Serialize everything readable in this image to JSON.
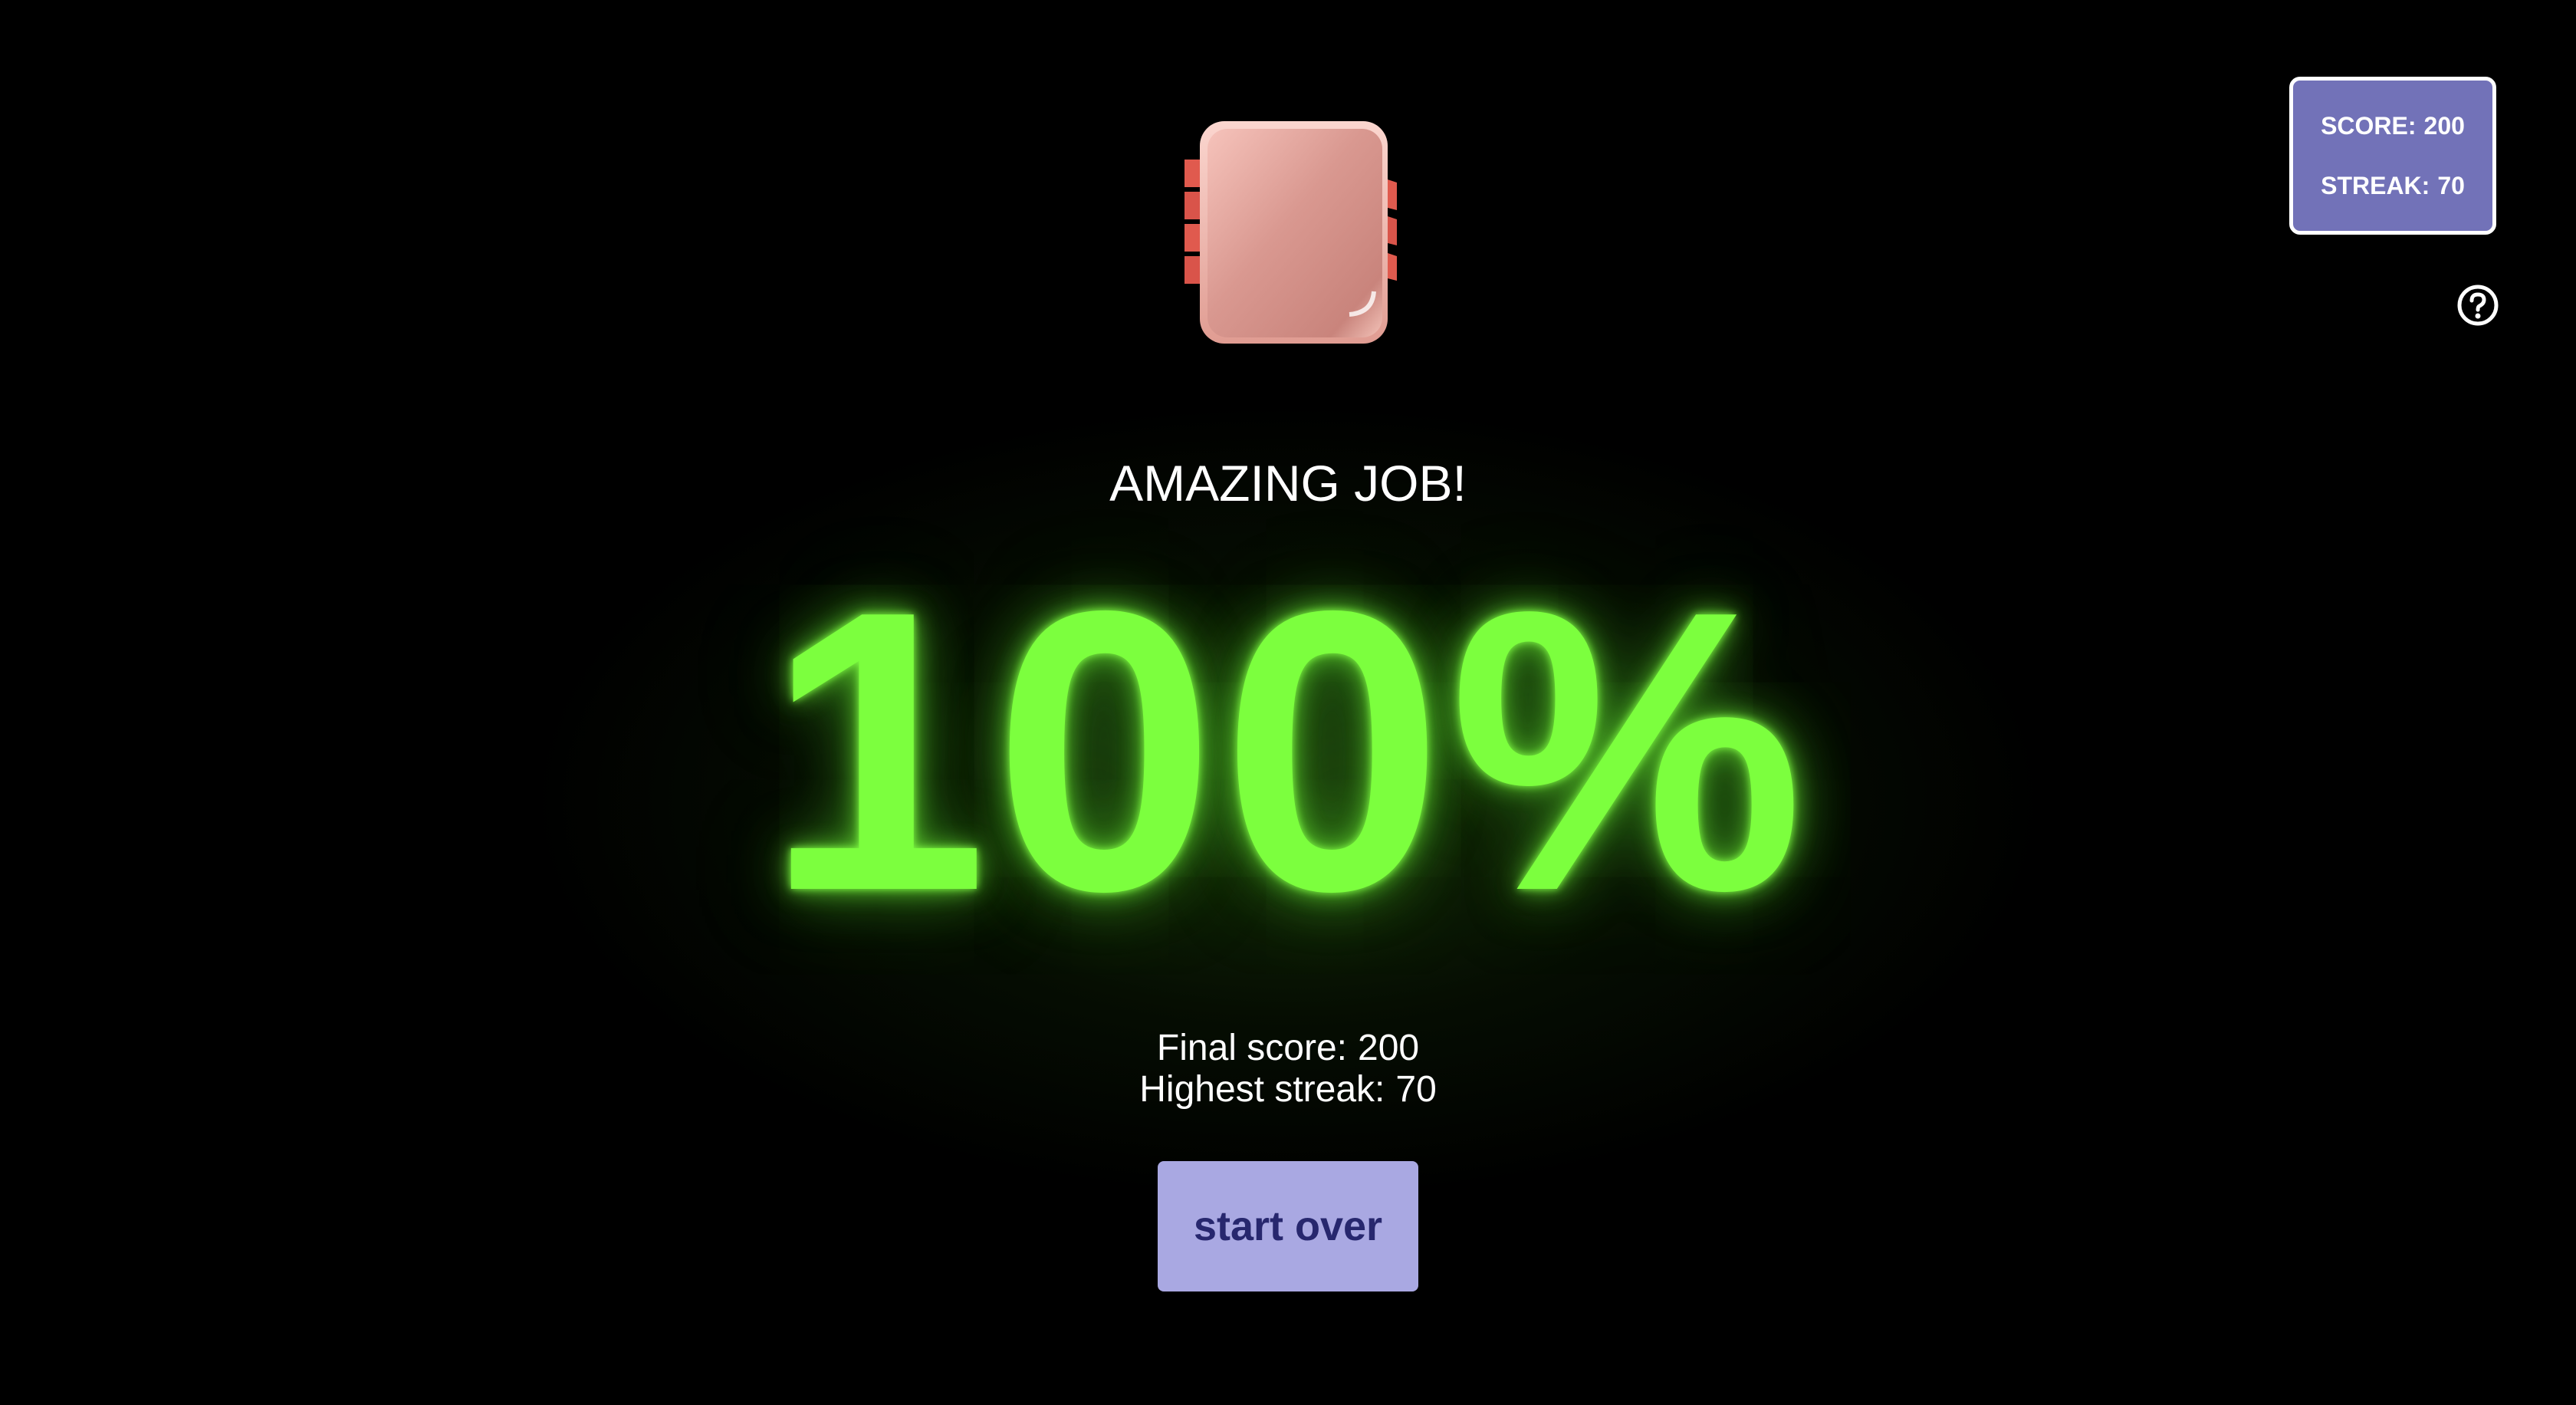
{
  "hud": {
    "score_label": "SCORE:",
    "score_value": "200",
    "streak_label": "STREAK:",
    "streak_value": "70"
  },
  "help": {
    "icon": "question-circle-icon"
  },
  "mascot": {
    "icon": "chip-icon"
  },
  "result": {
    "headline": "AMAZING JOB!",
    "percent": "100%",
    "final_score_label": "Final score:",
    "final_score_value": "200",
    "highest_streak_label": "Highest streak:",
    "highest_streak_value": "70"
  },
  "actions": {
    "start_over_label": "start over"
  },
  "colors": {
    "background": "#000000",
    "percent_glow": "#7cff3e",
    "hud_background": "#7272b8",
    "button_background": "#a9a8e2",
    "button_text": "#27276e",
    "chip_body": "#e8a39a",
    "chip_pins": "#e05a4e"
  }
}
